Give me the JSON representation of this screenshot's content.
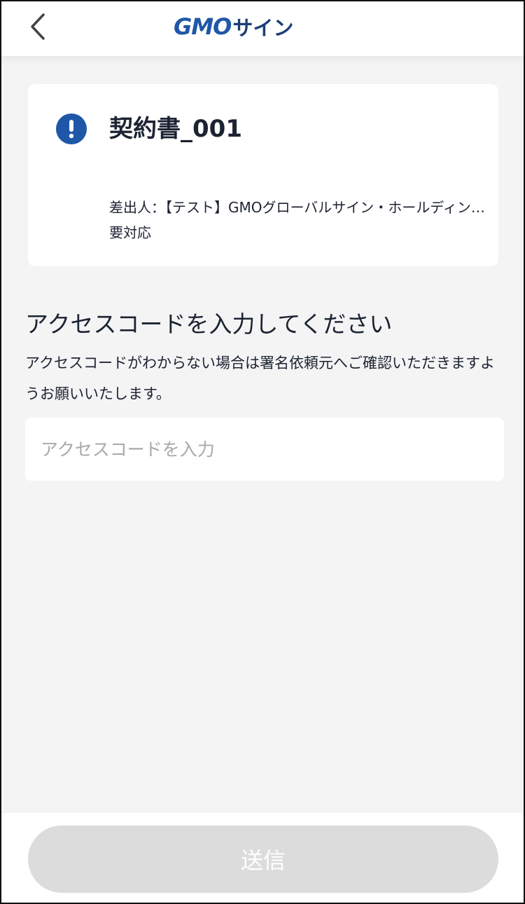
{
  "header": {
    "back_icon": "chevron-left-icon",
    "logo_gmo": "GMO",
    "logo_sign": "サイン",
    "brand_color": "#1f57a8"
  },
  "document": {
    "status_icon": "exclamation-circle-icon",
    "title": "契約書_001",
    "sender": "差出人：【テスト】GMOグローバルサイン・ホールディングス株式会社",
    "status": "要対応"
  },
  "access": {
    "heading": "アクセスコードを入力してください",
    "description": "アクセスコードがわからない場合は署名依頼元へご確認いただきますようお願いいたします。",
    "placeholder": "アクセスコードを入力",
    "value": ""
  },
  "footer": {
    "submit_label": "送信",
    "submit_disabled_color": "#dcdcdc"
  }
}
